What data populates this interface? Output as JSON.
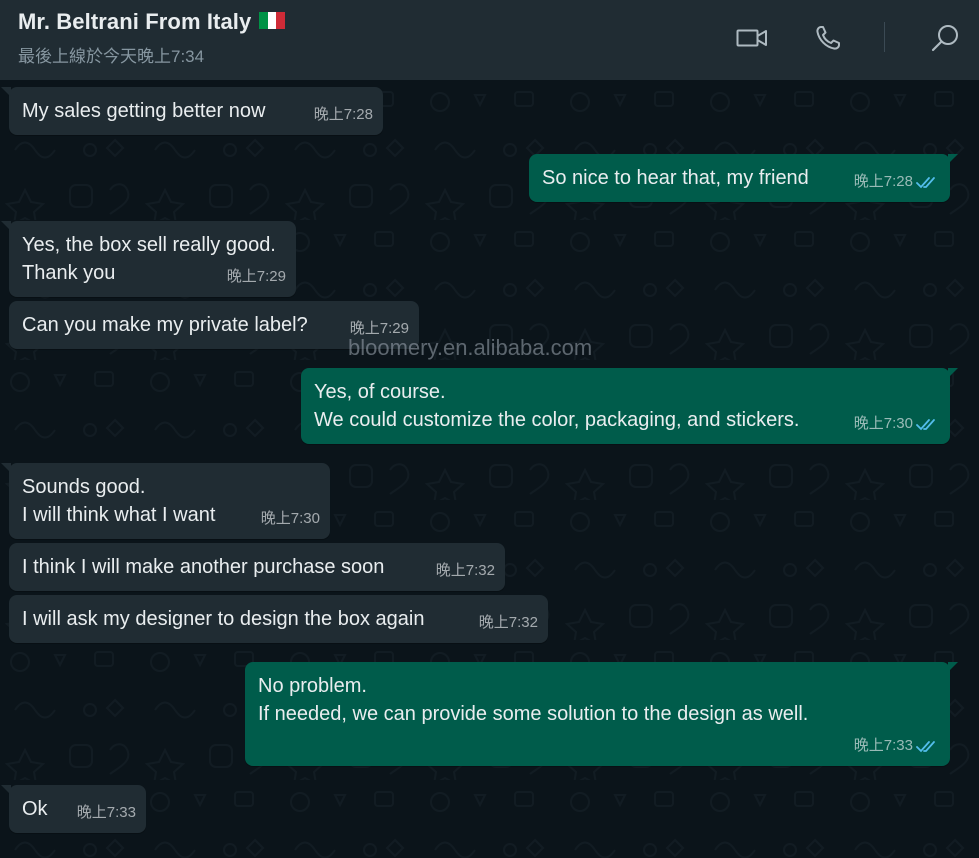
{
  "header": {
    "contact_name": "Mr. Beltrani From Italy",
    "flag_icon": "italy-flag-icon",
    "last_seen": "最後上線於今天晚上7:34",
    "icons": [
      "video-call-icon",
      "voice-call-icon",
      "search-icon"
    ]
  },
  "colors": {
    "header_bg": "#202c33",
    "chat_bg": "#0b141a",
    "incoming_bubble": "#202c33",
    "outgoing_bubble": "#005c4b",
    "read_tick": "#53bdeb"
  },
  "messages": [
    {
      "direction": "in",
      "text": "My sales getting better now",
      "time": "晚上7:28"
    },
    {
      "direction": "out",
      "text": "So nice to hear that, my friend",
      "time": "晚上7:28",
      "status": "read"
    },
    {
      "direction": "in",
      "text": "Yes, the box sell really good.\nThank you",
      "time": "晚上7:29"
    },
    {
      "direction": "in",
      "text": "Can you make my private label?",
      "time": "晚上7:29"
    },
    {
      "direction": "out",
      "text": "Yes, of course.\nWe could customize the color, packaging, and stickers.",
      "time": "晚上7:30",
      "status": "read"
    },
    {
      "direction": "in",
      "text": "Sounds good.\nI will think what I want",
      "time": "晚上7:30"
    },
    {
      "direction": "in",
      "text": "I think I will make another purchase soon",
      "time": "晚上7:32"
    },
    {
      "direction": "in",
      "text": "I will ask my designer to design the box again",
      "time": "晚上7:32"
    },
    {
      "direction": "out",
      "text": "No problem.\nIf needed, we can provide some solution to the design as well.",
      "time": "晚上7:33",
      "status": "read"
    },
    {
      "direction": "in",
      "text": "Ok",
      "time": "晚上7:33"
    }
  ],
  "watermark": "bloomery.en.alibaba.com"
}
